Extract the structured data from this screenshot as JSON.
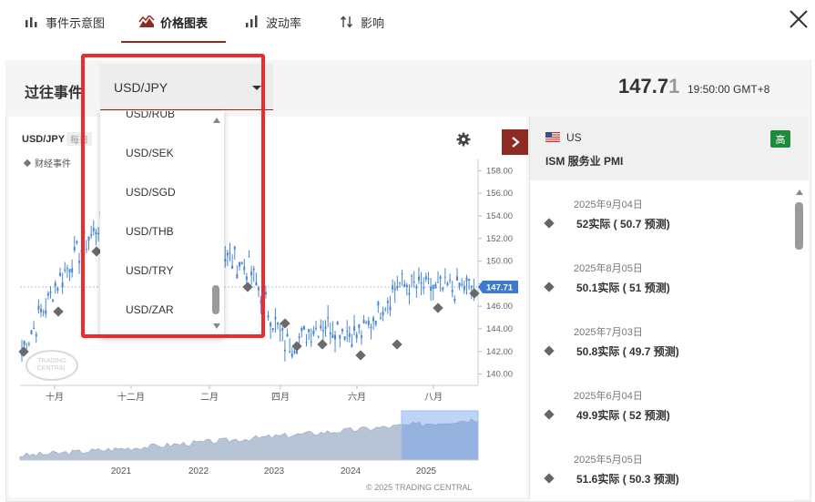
{
  "tabs": [
    {
      "label": "事件示意图",
      "icon": "bar-chart-icon",
      "active": false
    },
    {
      "label": "价格图表",
      "icon": "mountain-chart-icon",
      "active": true
    },
    {
      "label": "波动率",
      "icon": "volatility-icon",
      "active": false
    },
    {
      "label": "影响",
      "icon": "impact-arrows-icon",
      "active": false
    }
  ],
  "header": {
    "past_label": "过往事件",
    "selected_pair": "USD/JPY",
    "price_main": "147.7",
    "price_last_digit": "1",
    "time": "19:50:00 GMT+8"
  },
  "dropdown": {
    "options": [
      "USD/RUB",
      "USD/SEK",
      "USD/SGD",
      "USD/THB",
      "USD/TRY",
      "USD/ZAR"
    ]
  },
  "chart": {
    "pair": "USD/JPY",
    "period": "每日",
    "legend": "财经事件",
    "current_price_tag": "147.71",
    "y_ticks": [
      "158.00",
      "156.00",
      "154.00",
      "152.00",
      "150.00",
      "148.00",
      "146.00",
      "144.00",
      "142.00",
      "140.00"
    ],
    "x_ticks": [
      "十月",
      "十二月",
      "二月",
      "四月",
      "六月",
      "八月"
    ],
    "nav_years": [
      "2021",
      "2022",
      "2023",
      "2024",
      "2025"
    ],
    "watermark": "TRADING CENTRAL",
    "copyright": "© 2025 TRADING CENTRAL",
    "accent": "#4a86d6"
  },
  "chart_data": {
    "type": "line",
    "title": "",
    "xlabel": "",
    "ylabel": "",
    "ylim": [
      139,
      159
    ],
    "x": [
      "2024-09",
      "2024-10",
      "2024-11",
      "2024-12",
      "2025-01",
      "2025-02",
      "2025-03",
      "2025-04",
      "2025-05",
      "2025-06",
      "2025-07",
      "2025-08",
      "2025-09"
    ],
    "series": [
      {
        "values": [
          142.0,
          148.5,
          153.0,
          156.5,
          157.0,
          151.0,
          149.5,
          142.5,
          144.5,
          143.5,
          148.0,
          147.5,
          147.7
        ]
      }
    ]
  },
  "events_panel": {
    "country": "US",
    "title": "ISM 服务业 PMI",
    "importance": "高",
    "importance_color": "#1e8a3c",
    "items": [
      {
        "date": "2025年9月04日",
        "value": "52实际 ( 50.7 预测)"
      },
      {
        "date": "2025年8月05日",
        "value": "50.1实际 ( 51 预测)"
      },
      {
        "date": "2025年7月03日",
        "value": "50.8实际 ( 49.7 预测)"
      },
      {
        "date": "2025年6月04日",
        "value": "49.9实际 ( 52 预测)"
      },
      {
        "date": "2025年5月05日",
        "value": "51.6实际 ( 50.3 预测)"
      }
    ]
  }
}
